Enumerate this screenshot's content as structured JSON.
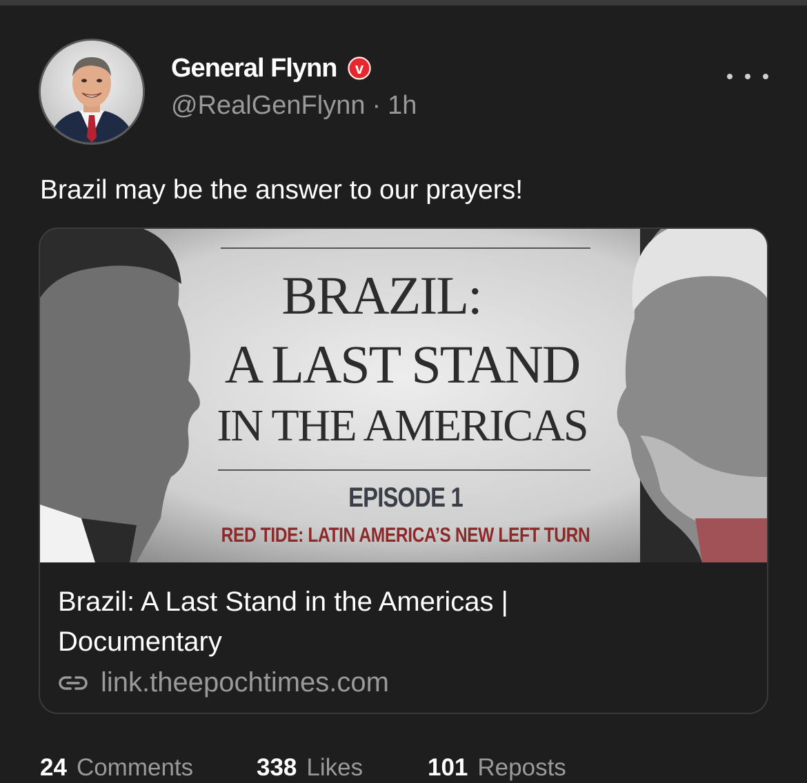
{
  "post": {
    "author": {
      "display_name": "General Flynn",
      "handle": "@RealGenFlynn",
      "separator": "·",
      "time": "1h",
      "badge_letter": "v",
      "badge_color": "#e8262d"
    },
    "text": "Brazil may be the answer to our prayers!",
    "link_card": {
      "thumbnail": {
        "line1": "BRAZIL:",
        "line2": "A LAST STAND",
        "line3": "IN THE AMERICAS",
        "episode": "EPISODE 1",
        "subtitle": "RED TIDE: LATIN AMERICA’S NEW LEFT TURN"
      },
      "title": "Brazil: A Last Stand in the Americas | Documentary",
      "domain": "link.theepochtimes.com",
      "icon": "link-icon"
    },
    "stats": {
      "comments_count": "24",
      "comments_label": "Comments",
      "likes_count": "338",
      "likes_label": "Likes",
      "reposts_count": "101",
      "reposts_label": "Reposts"
    }
  },
  "icons": {
    "more": "more-options-icon",
    "verified": "verified-badge-icon"
  },
  "colors": {
    "background": "#1e1e1e",
    "muted_text": "#9a9a9a",
    "card_border": "#3b3b3b",
    "subtitle_red": "#8c2a2a"
  }
}
